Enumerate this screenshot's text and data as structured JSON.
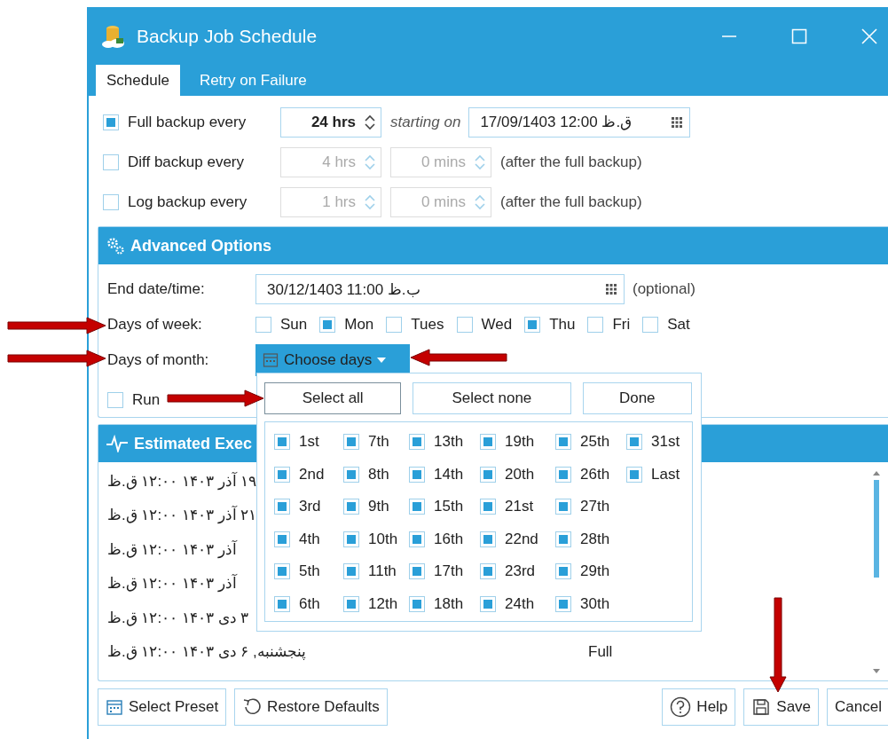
{
  "window": {
    "title": "Backup Job Schedule"
  },
  "tabs": [
    {
      "label": "Schedule",
      "selected": true
    },
    {
      "label": "Retry on Failure",
      "selected": false
    }
  ],
  "schedule_rows": [
    {
      "kind": "start",
      "label": "Full backup every",
      "checked": true,
      "disabled": false,
      "hours": "24 hrs",
      "starting_label": "starting on",
      "start_value": "17/09/1403 12:00 ق.ظ"
    },
    {
      "kind": "interval",
      "label": "Diff backup every",
      "checked": false,
      "disabled": true,
      "hours": "4 hrs",
      "minutes": "0 mins",
      "note": "(after the full backup)"
    },
    {
      "kind": "interval",
      "label": "Log backup every",
      "checked": false,
      "disabled": true,
      "hours": "1 hrs",
      "minutes": "0 mins",
      "note": "(after the full backup)"
    }
  ],
  "advanced": {
    "title": "Advanced Options",
    "end_label": "End date/time:",
    "end_value": "30/12/1403 11:00 ب.ظ",
    "end_note": "(optional)",
    "week_label": "Days of week:",
    "weekdays": [
      {
        "label": "Sun",
        "checked": false
      },
      {
        "label": "Mon",
        "checked": true
      },
      {
        "label": "Tues",
        "checked": false
      },
      {
        "label": "Wed",
        "checked": false
      },
      {
        "label": "Thu",
        "checked": true
      },
      {
        "label": "Fri",
        "checked": false
      },
      {
        "label": "Sat",
        "checked": false
      }
    ],
    "month_label": "Days of month:",
    "month_button": "Choose days",
    "run_label": "Run",
    "run_checked": false
  },
  "day_picker": {
    "buttons": [
      {
        "label": "Select all",
        "focused": true
      },
      {
        "label": "Select none",
        "focused": false
      },
      {
        "label": "Done",
        "focused": false
      }
    ],
    "days": [
      {
        "label": "1st",
        "checked": true
      },
      {
        "label": "2nd",
        "checked": true
      },
      {
        "label": "3rd",
        "checked": true
      },
      {
        "label": "4th",
        "checked": true
      },
      {
        "label": "5th",
        "checked": true
      },
      {
        "label": "6th",
        "checked": true
      },
      {
        "label": "7th",
        "checked": true
      },
      {
        "label": "8th",
        "checked": true
      },
      {
        "label": "9th",
        "checked": true
      },
      {
        "label": "10th",
        "checked": true
      },
      {
        "label": "11th",
        "checked": true
      },
      {
        "label": "12th",
        "checked": true
      },
      {
        "label": "13th",
        "checked": true
      },
      {
        "label": "14th",
        "checked": true
      },
      {
        "label": "15th",
        "checked": true
      },
      {
        "label": "16th",
        "checked": true
      },
      {
        "label": "17th",
        "checked": true
      },
      {
        "label": "18th",
        "checked": true
      },
      {
        "label": "19th",
        "checked": true
      },
      {
        "label": "20th",
        "checked": true
      },
      {
        "label": "21st",
        "checked": true
      },
      {
        "label": "22nd",
        "checked": true
      },
      {
        "label": "23rd",
        "checked": true
      },
      {
        "label": "24th",
        "checked": true
      },
      {
        "label": "25th",
        "checked": true
      },
      {
        "label": "26th",
        "checked": true
      },
      {
        "label": "27th",
        "checked": true
      },
      {
        "label": "28th",
        "checked": true
      },
      {
        "label": "29th",
        "checked": true
      },
      {
        "label": "30th",
        "checked": true
      },
      {
        "label": "31st",
        "checked": true
      },
      {
        "label": "Last",
        "checked": true
      }
    ]
  },
  "estimated": {
    "title": "Estimated Exec",
    "rows": [
      {
        "when": "۱۹ آذر ۱۴۰۳ ۱۲:۰۰ ق.ظ"
      },
      {
        "when": "۲۱ آذر ۱۴۰۳ ۱۲:۰۰ ق.ظ"
      },
      {
        "when": "آذر ۱۴۰۳ ۱۲:۰۰ ق.ظ"
      },
      {
        "when": "آذر ۱۴۰۳ ۱۲:۰۰ ق.ظ"
      },
      {
        "when": "۳ دی ۱۴۰۳ ۱۲:۰۰ ق.ظ"
      },
      {
        "when": "پنجشنبه, ۶ دی ۱۴۰۳ ۱۲:۰۰ ق.ظ",
        "type": "Full"
      }
    ]
  },
  "footer_buttons": [
    {
      "label": "Select Preset",
      "kind": "preset"
    },
    {
      "label": "Restore Defaults",
      "kind": "restore"
    },
    {
      "label": "Help",
      "kind": "help"
    },
    {
      "label": "Save",
      "kind": "save"
    },
    {
      "label": "Cancel",
      "kind": "cancel"
    }
  ],
  "callout_arrows": [
    {
      "kind": "rightward"
    },
    {
      "kind": "rightward"
    },
    {
      "kind": "leftward"
    },
    {
      "kind": "rightward"
    },
    {
      "kind": "downward"
    }
  ]
}
